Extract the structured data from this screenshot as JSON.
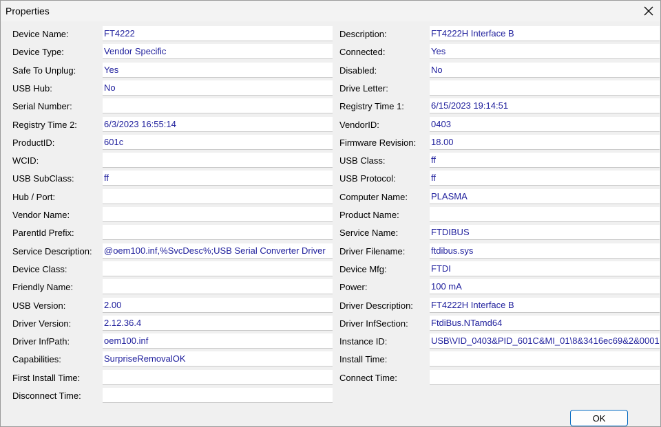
{
  "window": {
    "title": "Properties"
  },
  "buttons": {
    "ok_label": "OK"
  },
  "left_column": [
    {
      "label": "Device Name:",
      "value": "FT4222"
    },
    {
      "label": "Device Type:",
      "value": "Vendor Specific"
    },
    {
      "label": "Safe To Unplug:",
      "value": "Yes"
    },
    {
      "label": "USB Hub:",
      "value": "No"
    },
    {
      "label": "Serial Number:",
      "value": ""
    },
    {
      "label": "Registry Time 2:",
      "value": "6/3/2023 16:55:14"
    },
    {
      "label": "ProductID:",
      "value": "601c"
    },
    {
      "label": "WCID:",
      "value": ""
    },
    {
      "label": "USB SubClass:",
      "value": "ff"
    },
    {
      "label": "Hub / Port:",
      "value": ""
    },
    {
      "label": "Vendor Name:",
      "value": ""
    },
    {
      "label": "ParentId Prefix:",
      "value": ""
    },
    {
      "label": "Service Description:",
      "value": "@oem100.inf,%SvcDesc%;USB Serial Converter Driver"
    },
    {
      "label": "Device Class:",
      "value": ""
    },
    {
      "label": "Friendly Name:",
      "value": ""
    },
    {
      "label": "USB Version:",
      "value": "2.00"
    },
    {
      "label": "Driver Version:",
      "value": "2.12.36.4"
    },
    {
      "label": "Driver InfPath:",
      "value": "oem100.inf"
    },
    {
      "label": "Capabilities:",
      "value": "SurpriseRemovalOK"
    },
    {
      "label": "First Install Time:",
      "value": ""
    },
    {
      "label": "Disconnect Time:",
      "value": ""
    }
  ],
  "right_column": [
    {
      "label": "Description:",
      "value": "FT4222H Interface B"
    },
    {
      "label": "Connected:",
      "value": "Yes"
    },
    {
      "label": "Disabled:",
      "value": "No"
    },
    {
      "label": "Drive Letter:",
      "value": ""
    },
    {
      "label": "Registry Time 1:",
      "value": "6/15/2023 19:14:51"
    },
    {
      "label": "VendorID:",
      "value": "0403"
    },
    {
      "label": "Firmware Revision:",
      "value": "18.00"
    },
    {
      "label": "USB Class:",
      "value": "ff"
    },
    {
      "label": "USB Protocol:",
      "value": "ff"
    },
    {
      "label": "Computer Name:",
      "value": "PLASMA"
    },
    {
      "label": "Product Name:",
      "value": ""
    },
    {
      "label": "Service Name:",
      "value": "FTDIBUS"
    },
    {
      "label": "Driver Filename:",
      "value": "ftdibus.sys"
    },
    {
      "label": "Device Mfg:",
      "value": "FTDI"
    },
    {
      "label": "Power:",
      "value": "100 mA"
    },
    {
      "label": "Driver Description:",
      "value": "FT4222H Interface B"
    },
    {
      "label": "Driver InfSection:",
      "value": "FtdiBus.NTamd64"
    },
    {
      "label": "Instance ID:",
      "value": "USB\\VID_0403&PID_601C&MI_01\\8&3416ec69&2&0001"
    },
    {
      "label": "Install Time:",
      "value": ""
    },
    {
      "label": "Connect Time:",
      "value": ""
    }
  ],
  "icons": {
    "close": "close-icon"
  }
}
